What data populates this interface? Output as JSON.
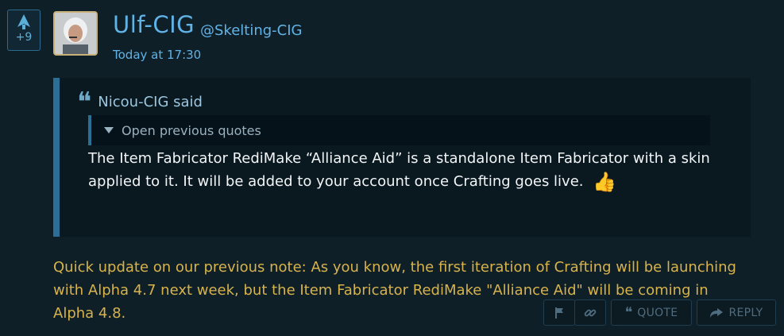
{
  "vote": {
    "count": "+9",
    "icon": "up-arrow-icon"
  },
  "post": {
    "author": "Ulf-CIG",
    "handle": "@Skelting-CIG",
    "timestamp": "Today at 17:30",
    "avatar_icon": "user-avatar"
  },
  "quote": {
    "author": "Nicou-CIG said",
    "previous_label": "Open previous quotes",
    "body": "The Item Fabricator RediMake “Alliance Aid” is a standalone Item Fabricator with a skin applied to it. It will be added to your account once Crafting goes live.",
    "emoji": "👍"
  },
  "message": "Quick update on our previous note: As you know, the first iteration of Crafting will be launching with Alpha 4.7 next week, but the Item Fabricator RediMake \"Alliance Aid\" will be coming in Alpha 4.8.",
  "actions": {
    "report_icon": "flag-icon",
    "link_icon": "link-icon",
    "quote_label": "QUOTE",
    "reply_label": "REPLY"
  },
  "colors": {
    "background": "#0f1f28",
    "accent": "#5fb3e6",
    "quote_border": "#2b6e96",
    "message_text": "#d7b34a"
  }
}
